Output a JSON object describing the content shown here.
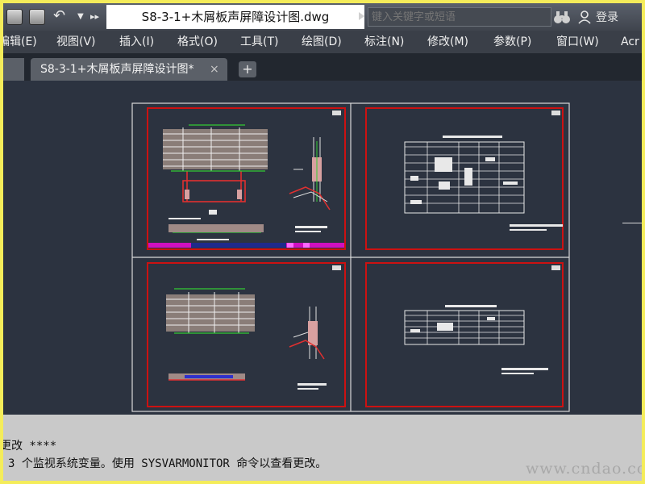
{
  "titlebar": {
    "document_title": "S8-3-1+木屑板声屏障设计图.dwg",
    "search_placeholder": "键入关键字或短语",
    "login_label": "登录"
  },
  "menu": {
    "items": [
      "编辑(E)",
      "视图(V)",
      "插入(I)",
      "格式(O)",
      "工具(T)",
      "绘图(D)",
      "标注(N)",
      "修改(M)",
      "参数(P)",
      "窗口(W)",
      "Acr"
    ]
  },
  "tabs": {
    "active_label": "S8-3-1+木屑板声屏障设计图*",
    "close_glyph": "×",
    "add_glyph": "+"
  },
  "command": {
    "line1": "更改 ****",
    "line2": "3 个监视系统变量。使用 SYSVARMONITOR 命令以查看更改。"
  },
  "watermark": "www.cndao.com",
  "colors": {
    "app_frame": "#f4ec5a",
    "canvas_background": "#2c3340",
    "drawing_border": "#cc1111",
    "command_background": "#c9c9c9"
  }
}
